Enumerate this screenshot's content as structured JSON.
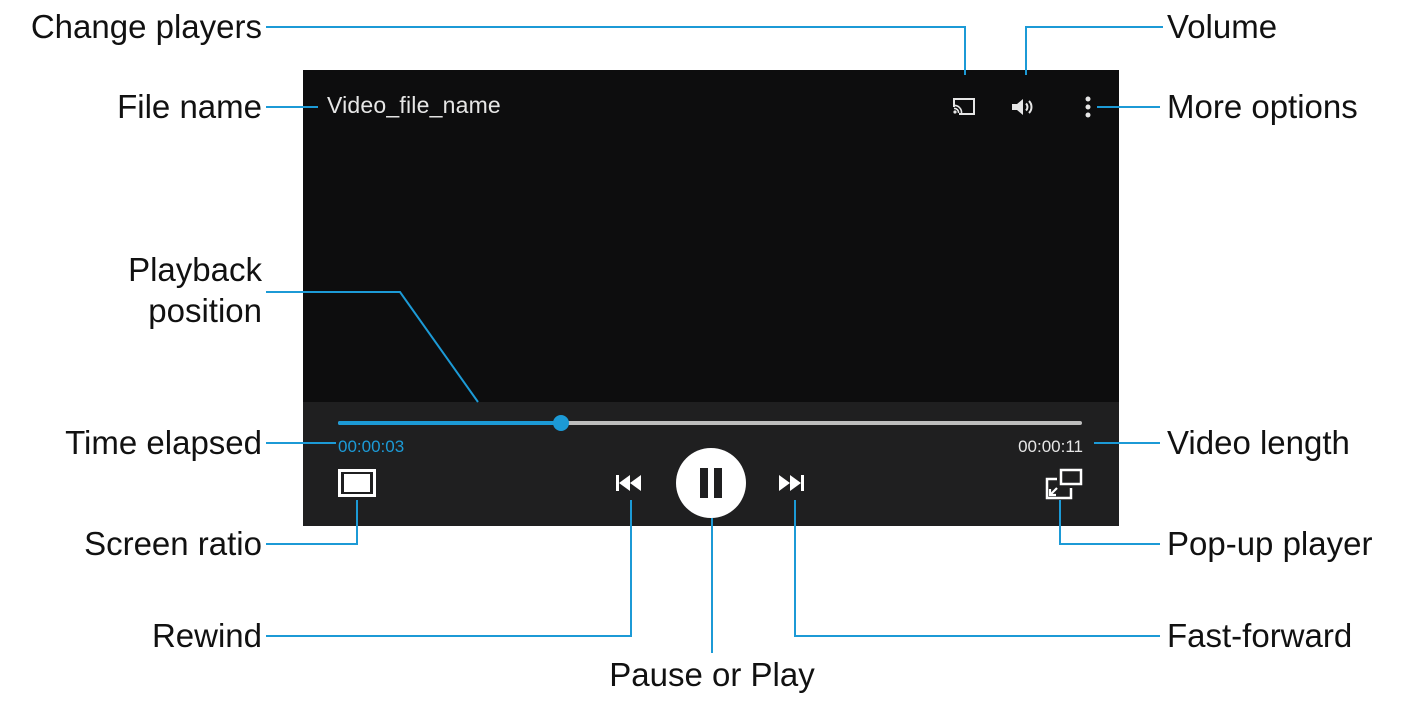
{
  "player": {
    "file_name": "Video_file_name",
    "time_elapsed": "00:00:03",
    "time_total": "00:00:11",
    "progress_fraction": 0.3,
    "accent_color": "#1c9ad6",
    "icons": {
      "cast": "change-players-icon",
      "volume": "volume-icon",
      "more": "more-options-icon",
      "ratio": "screen-ratio-icon",
      "rewind": "rewind-icon",
      "pause": "pause-icon",
      "fast_forward": "fast-forward-icon",
      "popup": "popup-player-icon"
    }
  },
  "callouts": {
    "change_players": "Change players",
    "volume": "Volume",
    "file_name": "File name",
    "more_options": "More options",
    "playback_position_line1": "Playback",
    "playback_position_line2": "position",
    "time_elapsed": "Time elapsed",
    "video_length": "Video length",
    "screen_ratio": "Screen ratio",
    "popup_player": "Pop-up player",
    "rewind": "Rewind",
    "fast_forward": "Fast-forward",
    "pause_or_play": "Pause or Play"
  },
  "colors": {
    "leader_line": "#1c9ad6",
    "player_bg": "#0d0d0e",
    "controls_bg": "#1f1f20"
  }
}
